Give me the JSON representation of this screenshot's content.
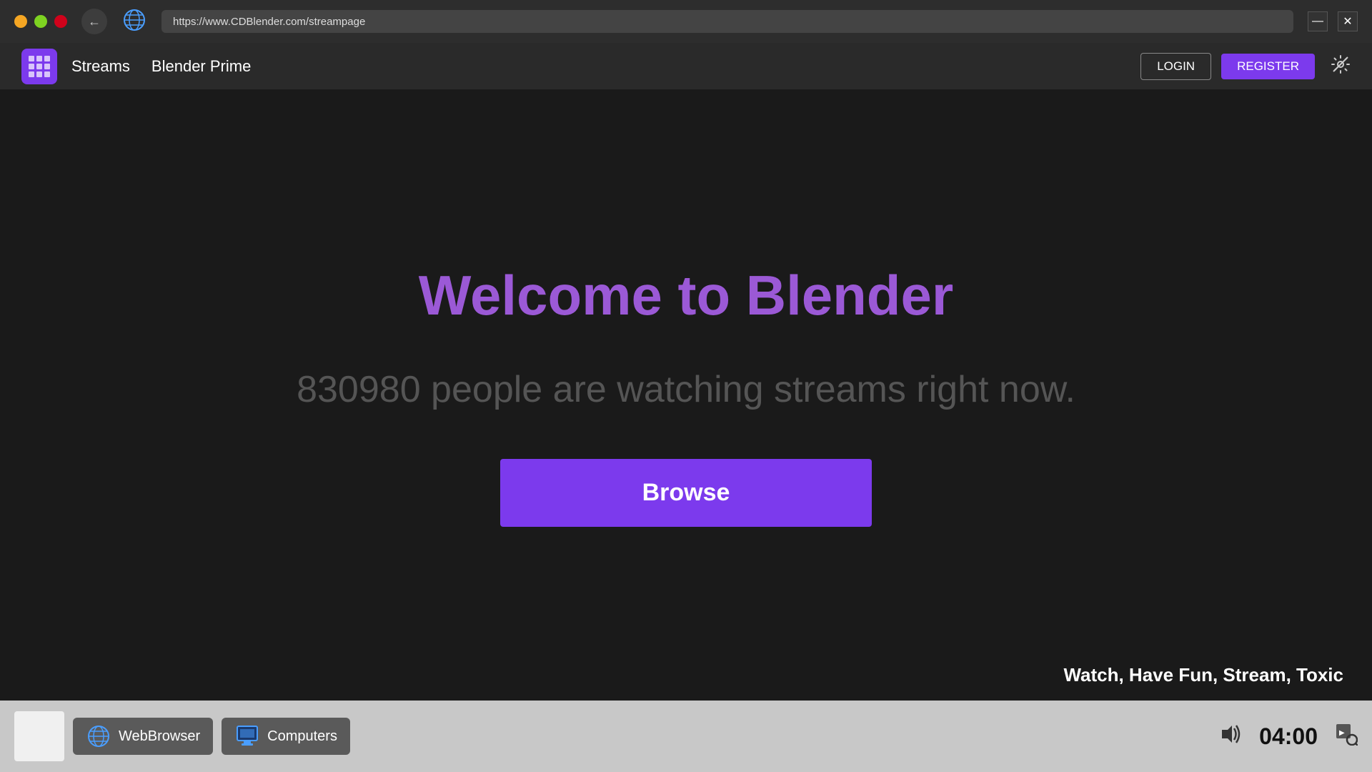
{
  "window": {
    "url": "https://www.CDBlender.com/streampage",
    "minimize_label": "—",
    "close_label": "✕"
  },
  "navbar": {
    "streams_label": "Streams",
    "blender_prime_label": "Blender Prime",
    "login_label": "LOGIN",
    "register_label": "REGISTER"
  },
  "hero": {
    "title": "Welcome to Blender",
    "subtitle_line": "830980 people are watching streams right now.",
    "browse_label": "Browse",
    "tagline": "Watch, Have Fun, Stream, Toxic"
  },
  "taskbar": {
    "web_browser_label": "WebBrowser",
    "computers_label": "Computers",
    "time": "04:00"
  }
}
